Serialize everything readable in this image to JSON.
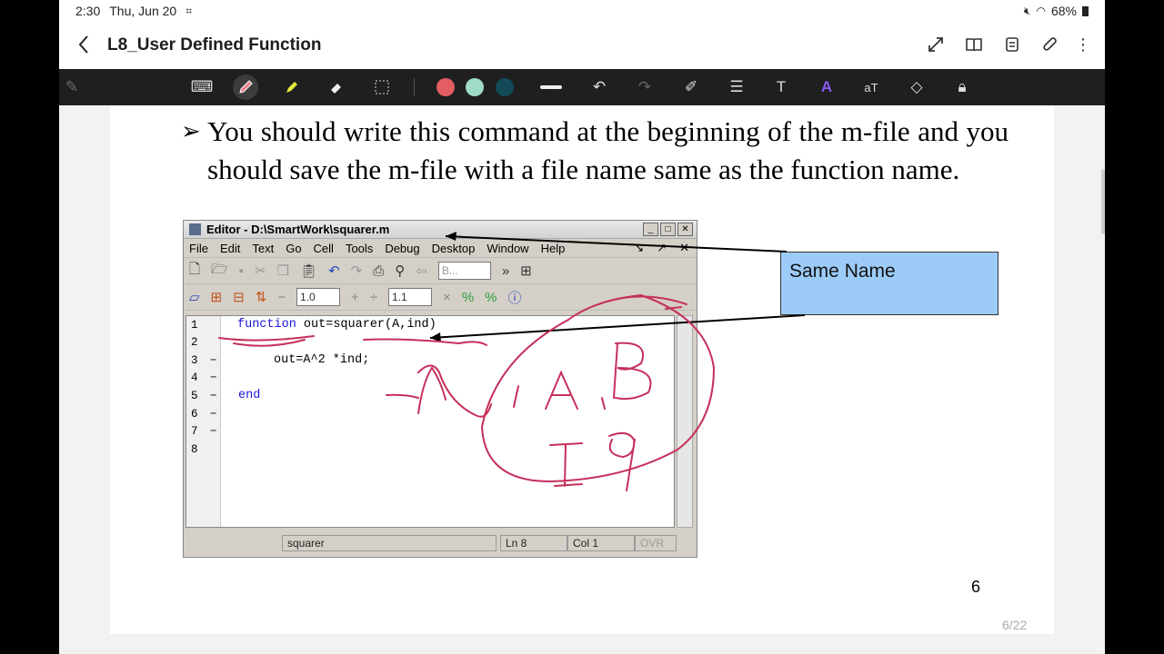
{
  "status_bar": {
    "time": "2:30",
    "date": "Thu, Jun 20",
    "battery": "68%"
  },
  "header": {
    "title": "L8_User Defined Function"
  },
  "toolbar": {
    "pen_colors": [
      "#e35d63",
      "#9fdcc6",
      "#124b57"
    ]
  },
  "slide": {
    "bullet_text": "You should write this command at the beginning of the m-file and you should save the m-file with a file name same as the function name.",
    "callout_text": "Same Name",
    "page_number": "6"
  },
  "editor": {
    "title": "Editor - D:\\SmartWork\\squarer.m",
    "menu": [
      "File",
      "Edit",
      "Text",
      "Go",
      "Cell",
      "Tools",
      "Debug",
      "Desktop",
      "Window",
      "Help"
    ],
    "toolbar_font_box": "B...",
    "field_1": "1.0",
    "field_2": "1.1",
    "line_numbers": [
      "1",
      "2",
      "3",
      "4",
      "5",
      "6",
      "7",
      "8"
    ],
    "code_line1_keyword": "function",
    "code_line1_rest": " out=squarer(A,ind)",
    "code_line3": "out=A^2 *ind;",
    "code_line5_keyword": "end",
    "status_file": "squarer",
    "status_ln": "Ln   8",
    "status_col": "Col   1",
    "status_ovr": "OVR"
  },
  "footer": {
    "page_counter": "6/22"
  }
}
